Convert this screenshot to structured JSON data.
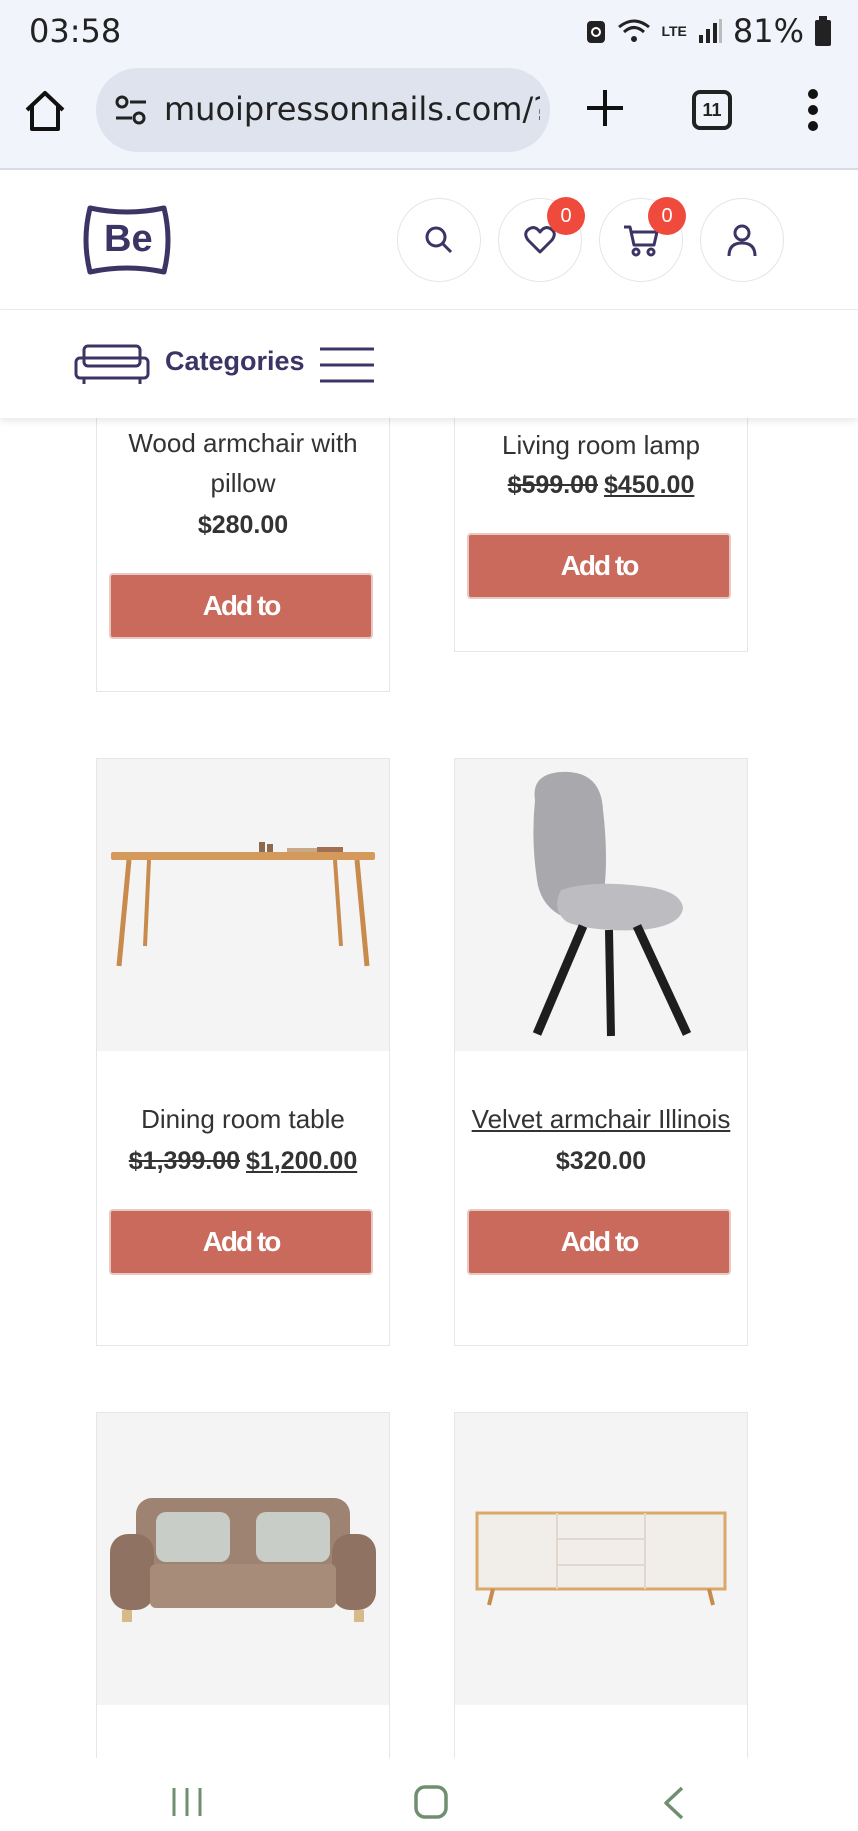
{
  "status": {
    "time": "03:58",
    "battery": "81%",
    "network": "LTE"
  },
  "browser": {
    "url": "muoipressonnails.com/?",
    "tab_count": "11"
  },
  "header": {
    "logo_text": "Be",
    "wishlist_count": "0",
    "cart_count": "0"
  },
  "categories": {
    "label": "Categories"
  },
  "products": [
    {
      "name": "Wood armchair with pillow",
      "price": "$280.00",
      "button": "Add to"
    },
    {
      "name": "Living room lamp",
      "old_price": "$599.00",
      "price": "$450.00",
      "button": "Add to"
    },
    {
      "name": "Dining room table",
      "old_price": "$1,399.00",
      "price": "$1,200.00",
      "button": "Add to"
    },
    {
      "name": "Velvet armchair Illinois",
      "price": "$320.00",
      "button": "Add to"
    }
  ],
  "colors": {
    "accent": "#c96a5c",
    "brand": "#3b3566",
    "badge": "#f04a3d"
  }
}
